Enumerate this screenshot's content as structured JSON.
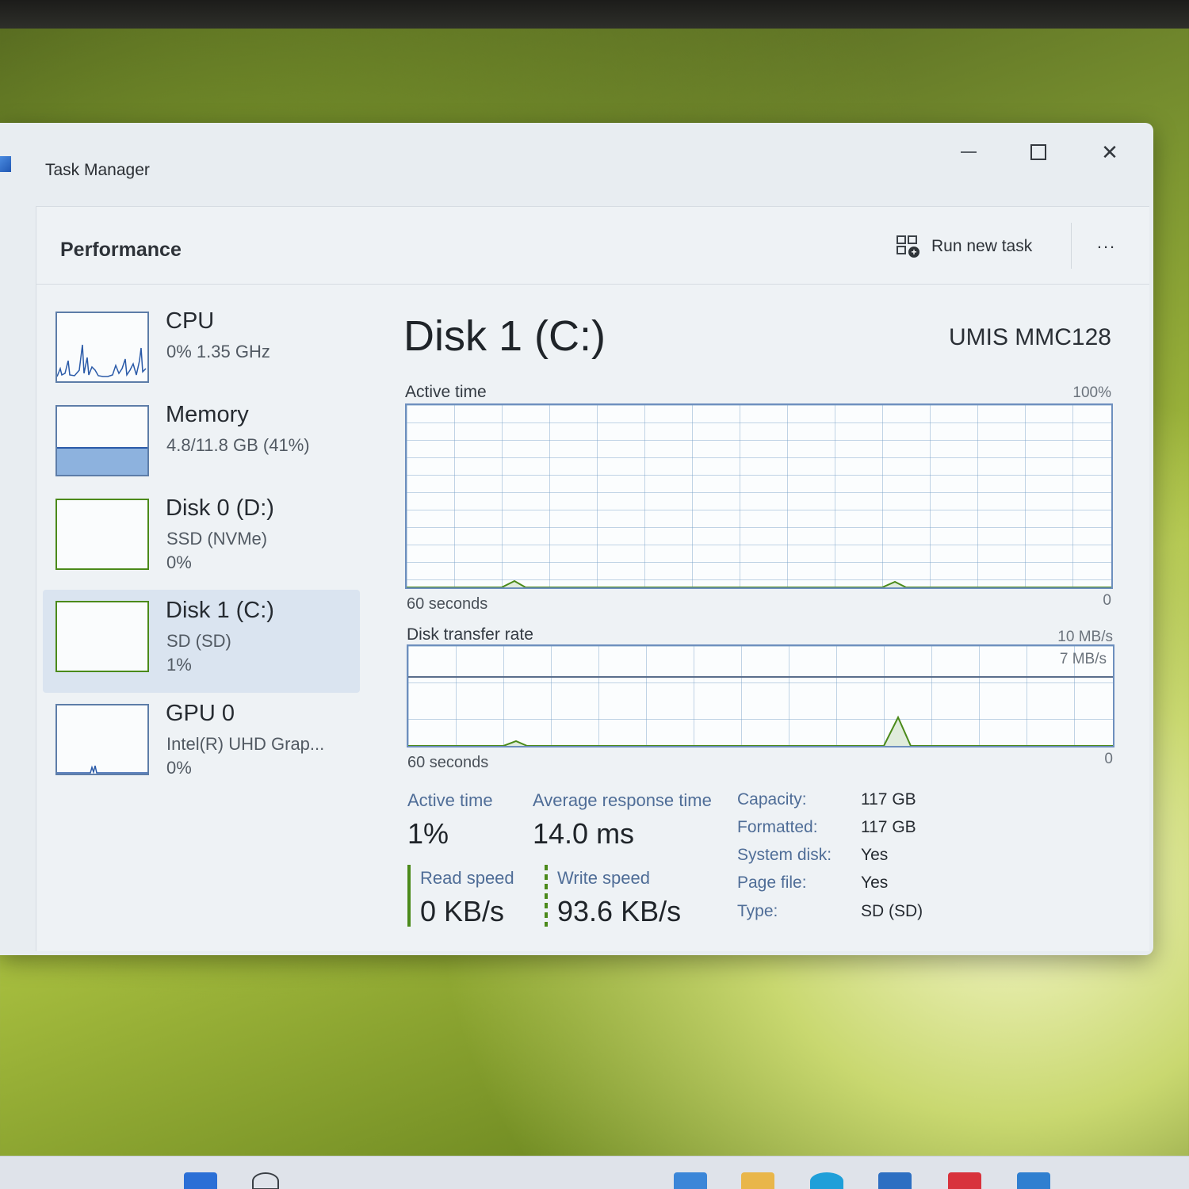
{
  "window": {
    "title": "Task Manager"
  },
  "header": {
    "page_title": "Performance",
    "run_new_task": "Run new task",
    "more": "..."
  },
  "colors": {
    "accent_disk": "#4b8a1a",
    "accent_cpu": "#2a5aa8",
    "graph_border": "#6d8fbe"
  },
  "resources": [
    {
      "name": "CPU",
      "sub1": "0% 1.35 GHz",
      "sub2": ""
    },
    {
      "name": "Memory",
      "sub1": "4.8/11.8 GB (41%)",
      "sub2": ""
    },
    {
      "name": "Disk 0 (D:)",
      "sub1": "SSD (NVMe)",
      "sub2": "0%"
    },
    {
      "name": "Disk 1 (C:)",
      "sub1": "SD (SD)",
      "sub2": "1%"
    },
    {
      "name": "GPU 0",
      "sub1": "Intel(R) UHD Grap...",
      "sub2": "0%"
    }
  ],
  "memory_usage_fraction": 0.41,
  "detail": {
    "title": "Disk 1 (C:)",
    "model": "UMIS MMC128",
    "active_time_graph": {
      "label": "Active time",
      "max": "100%",
      "min": "0",
      "duration": "60 seconds"
    },
    "transfer_graph": {
      "label": "Disk transfer rate",
      "max": "10 MB/s",
      "ref": "7 MB/s",
      "min": "0",
      "duration": "60 seconds"
    },
    "stats": {
      "active_time_label": "Active time",
      "active_time_value": "1%",
      "response_label": "Average response time",
      "response_value": "14.0 ms",
      "read_label": "Read speed",
      "read_value": "0 KB/s",
      "write_label": "Write speed",
      "write_value": "93.6 KB/s"
    },
    "properties": [
      {
        "label": "Capacity:",
        "value": "117 GB"
      },
      {
        "label": "Formatted:",
        "value": "117 GB"
      },
      {
        "label": "System disk:",
        "value": "Yes"
      },
      {
        "label": "Page file:",
        "value": "Yes"
      },
      {
        "label": "Type:",
        "value": "SD (SD)"
      }
    ]
  }
}
